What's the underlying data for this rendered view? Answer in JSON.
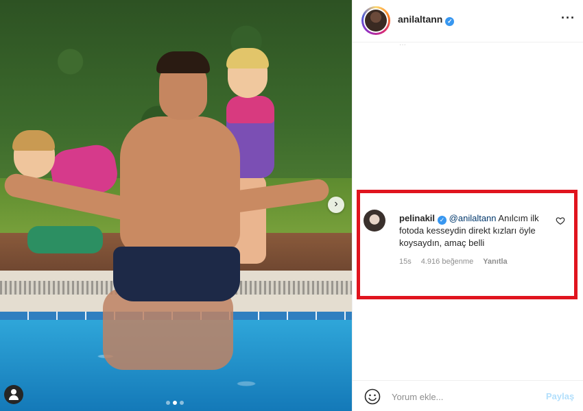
{
  "post": {
    "author": {
      "username": "anilaltann",
      "verified": true,
      "avatar_icon": "profile-avatar"
    },
    "photo": {
      "description_icon": "photo-content",
      "next_icon": "chevron-right-icon",
      "tag_icon": "user-tag-icon",
      "carousel_dots": 3,
      "carousel_active_index": 1
    },
    "top_hint": "···"
  },
  "highlighted_comment": {
    "username": "pelinakil",
    "verified": true,
    "mention": "@anilaltann",
    "text": "Anılcım ilk fotoda kesseydin direkt kızları öyle koysaydın, amaç belli",
    "time": "15s",
    "likes": "4.916 beğenme",
    "reply_label": "Yanıtla",
    "faded_text": "",
    "highlight_color": "#e0141e"
  },
  "footer": {
    "emoji_icon": "smiley-icon",
    "comment_placeholder": "Yorum ekle...",
    "post_label": "Paylaş"
  },
  "colors": {
    "verified": "#3897f0",
    "link": "#00376b",
    "post_disabled": "#b2dffc",
    "text": "#262626",
    "muted": "#8e8e8e"
  }
}
